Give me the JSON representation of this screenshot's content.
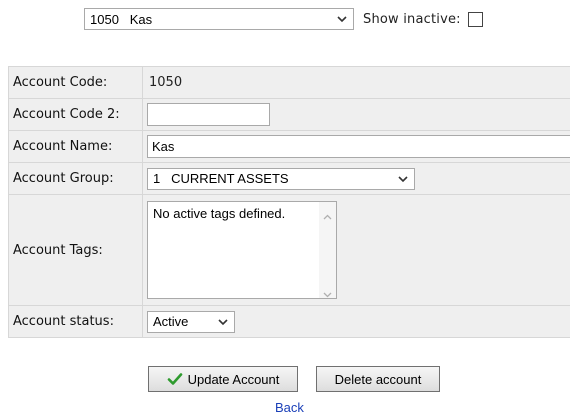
{
  "header": {
    "account_selector": {
      "value": "1050   Kas"
    },
    "show_inactive_label": "Show inactive:"
  },
  "form": {
    "account_code": {
      "label": "Account Code:",
      "value": "1050"
    },
    "account_code_2": {
      "label": "Account Code 2:",
      "value": ""
    },
    "account_name": {
      "label": "Account Name:",
      "value": "Kas"
    },
    "account_group": {
      "label": "Account Group:",
      "value": "1   CURRENT ASSETS"
    },
    "account_tags": {
      "label": "Account Tags:",
      "value": "No active tags defined."
    },
    "account_status": {
      "label": "Account status:",
      "value": "Active"
    }
  },
  "actions": {
    "update_label": "Update Account",
    "delete_label": "Delete account",
    "back_label": "Back"
  },
  "icons": {
    "update": "check-icon",
    "dropdown": "chevron-down-icon"
  },
  "colors": {
    "check": "#2e9b2e",
    "link": "#1a3fb8",
    "label_background": "#efefef"
  }
}
